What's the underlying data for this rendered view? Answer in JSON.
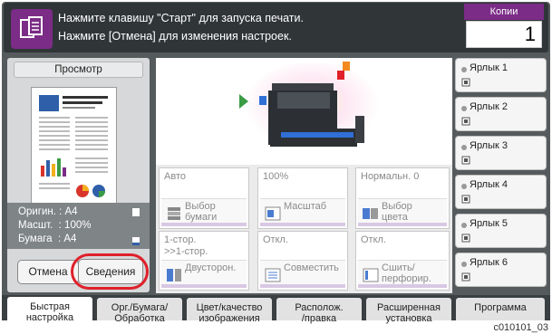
{
  "header": {
    "message_line1": "Нажмите клавишу \"Старт\" для запуска печати.",
    "message_line2": "Нажмите [Отмена] для изменения настроек.",
    "copies_label": "Копии",
    "copies_value": "1"
  },
  "left_panel": {
    "preview_label": "Просмотр",
    "original": "Оригин. : A4",
    "scale": "Масшт.  : 100%",
    "paper": "Бумага  : A4",
    "cancel_label": "Отмена",
    "details_label": "Сведения"
  },
  "functions": [
    {
      "value": "Авто",
      "label": "Выбор\nбумаги",
      "icon": "paper-select-icon"
    },
    {
      "value": "100%",
      "label": "Масштаб",
      "icon": "zoom-icon"
    },
    {
      "value": "Нормальн. 0",
      "label": "Выбор\nцвета",
      "icon": "color-select-icon"
    },
    {
      "value": "1-стор.\n>>1-стор.",
      "label": "Двусторон.",
      "icon": "duplex-icon"
    },
    {
      "value": "Откл.",
      "label": "Совместить",
      "icon": "combine-icon"
    },
    {
      "value": "Откл.",
      "label": "Сшить/\nперфорир.",
      "icon": "staple-punch-icon"
    }
  ],
  "shortcuts": [
    {
      "label": "Ярлык 1"
    },
    {
      "label": "Ярлык 2"
    },
    {
      "label": "Ярлык 3"
    },
    {
      "label": "Ярлык 4"
    },
    {
      "label": "Ярлык 5"
    },
    {
      "label": "Ярлык 6"
    }
  ],
  "tabs": [
    {
      "line1": "Быстрая",
      "line2": "настройка"
    },
    {
      "line1": "Орг./Бумага/",
      "line2": "Обработка"
    },
    {
      "line1": "Цвет/качество",
      "line2": "изображения"
    },
    {
      "line1": "Располож.",
      "line2": "/правка"
    },
    {
      "line1": "Расширенная",
      "line2": "установка"
    },
    {
      "line1": "Программа",
      "line2": ""
    }
  ],
  "figure_code": "c010101_03",
  "colors": {
    "accent": "#7b2c86",
    "highlight": "#e0202a"
  }
}
